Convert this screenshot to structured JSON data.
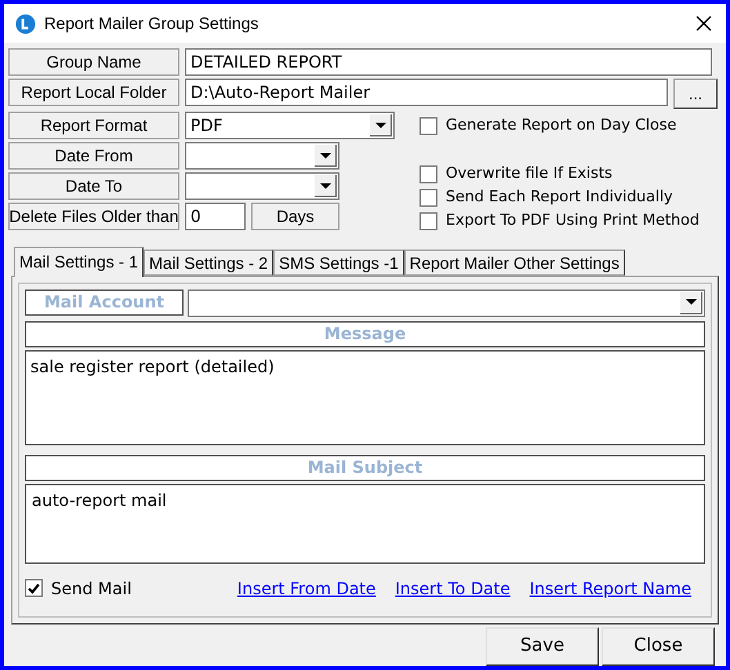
{
  "window": {
    "title": "Report Mailer Group Settings"
  },
  "group_name": {
    "label": "Group Name",
    "value": "DETAILED REPORT"
  },
  "report_local_folder": {
    "label": "Report Local Folder",
    "value": "D:\\Auto-Report Mailer",
    "browse": "..."
  },
  "report_format": {
    "label": "Report Format",
    "value": "PDF"
  },
  "date_from": {
    "label": "Date From"
  },
  "date_to": {
    "label": "Date To"
  },
  "delete_files": {
    "label": "Delete Files Older than",
    "value": "0",
    "unit": "Days"
  },
  "options": [
    {
      "label": "Generate Report on Day Close",
      "checked": false
    },
    {
      "label": "Overwrite file If Exists",
      "checked": false
    },
    {
      "label": "Send Each Report Individually",
      "checked": false
    },
    {
      "label": "Export To PDF Using Print Method",
      "checked": false
    }
  ],
  "tabs": [
    {
      "label": "Mail Settings - 1",
      "selected": true
    },
    {
      "label": "Mail Settings - 2",
      "selected": false
    },
    {
      "label": "SMS Settings -1",
      "selected": false
    },
    {
      "label": "Report Mailer Other Settings",
      "selected": false
    }
  ],
  "mail_account": {
    "label": "Mail Account"
  },
  "message": {
    "header": "Message",
    "value": "sale register report (detailed)"
  },
  "mail_subject": {
    "header": "Mail Subject",
    "value": "auto-report mail"
  },
  "send_mail": {
    "label": "Send Mail",
    "checked": true
  },
  "links": [
    "Insert From Date",
    "Insert To Date",
    "Insert Report Name"
  ],
  "buttons": [
    "Save",
    "Close"
  ]
}
